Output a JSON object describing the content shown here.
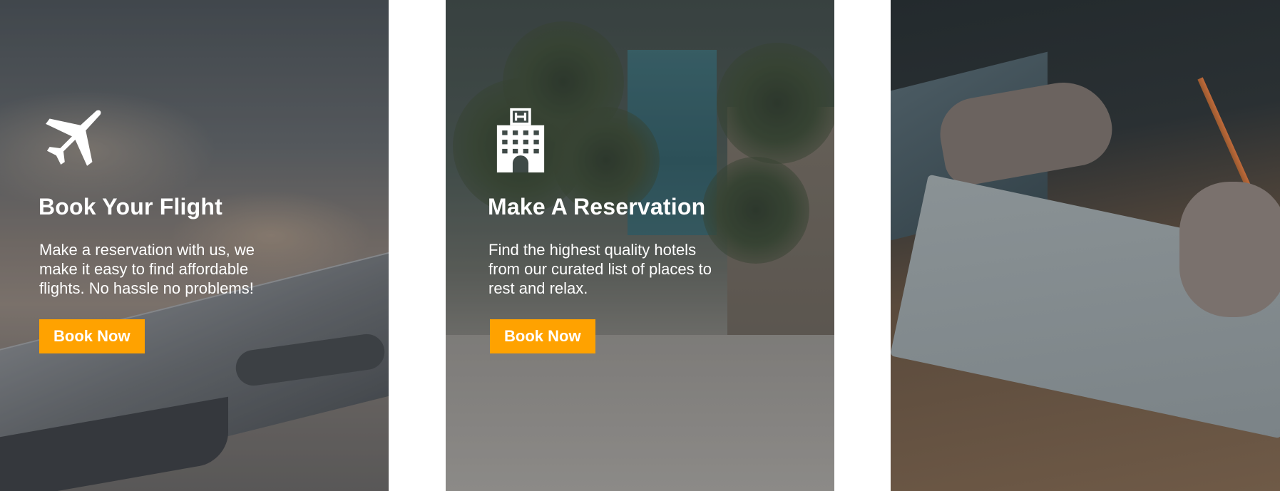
{
  "cards": [
    {
      "icon": "airplane-icon",
      "title": "Book Your Flight",
      "description": "Make a reservation with us, we make it easy to find affordable flights. No hassle no problems!",
      "button_label": "Book Now"
    },
    {
      "icon": "hotel-icon",
      "title": "Make A Reservation",
      "description": "Find the highest quality hotels from our curated list of places to rest and relax.",
      "button_label": "Book Now"
    },
    {
      "icon": "",
      "title": "",
      "description": "",
      "button_label": ""
    }
  ],
  "colors": {
    "accent": "#ffa200",
    "text": "#ffffff"
  }
}
